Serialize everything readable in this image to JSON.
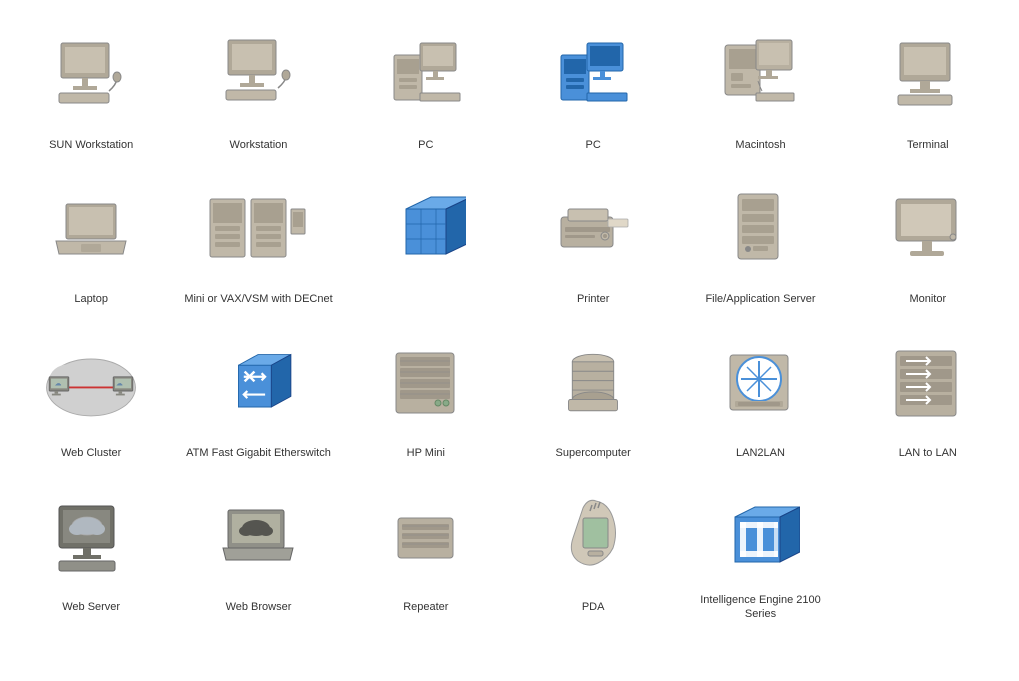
{
  "items": [
    {
      "id": "sun-workstation",
      "label": "SUN Workstation"
    },
    {
      "id": "workstation",
      "label": "Workstation"
    },
    {
      "id": "pc-gray",
      "label": "PC"
    },
    {
      "id": "pc-blue",
      "label": "PC"
    },
    {
      "id": "macintosh",
      "label": "Macintosh"
    },
    {
      "id": "terminal",
      "label": "Terminal"
    },
    {
      "id": "laptop",
      "label": "Laptop"
    },
    {
      "id": "mini-vax",
      "label": "Mini or VAX/VSM with DECnet"
    },
    {
      "id": "atm-cube",
      "label": ""
    },
    {
      "id": "printer",
      "label": "Printer"
    },
    {
      "id": "file-server",
      "label": "File/Application Server"
    },
    {
      "id": "monitor",
      "label": "Monitor"
    },
    {
      "id": "web-cluster",
      "label": "Web Cluster"
    },
    {
      "id": "atm-fast",
      "label": "ATM Fast Gigabit Etherswitch"
    },
    {
      "id": "hp-mini",
      "label": "HP Mini"
    },
    {
      "id": "supercomputer",
      "label": "Supercomputer"
    },
    {
      "id": "lan2lan",
      "label": "LAN2LAN"
    },
    {
      "id": "lan-to-lan",
      "label": "LAN to LAN"
    },
    {
      "id": "web-server",
      "label": "Web Server"
    },
    {
      "id": "web-browser",
      "label": "Web Browser"
    },
    {
      "id": "repeater",
      "label": "Repeater"
    },
    {
      "id": "pda",
      "label": "PDA"
    },
    {
      "id": "intelligence-engine",
      "label": "Intelligence Engine 2100 Series"
    },
    {
      "id": "empty",
      "label": ""
    }
  ]
}
